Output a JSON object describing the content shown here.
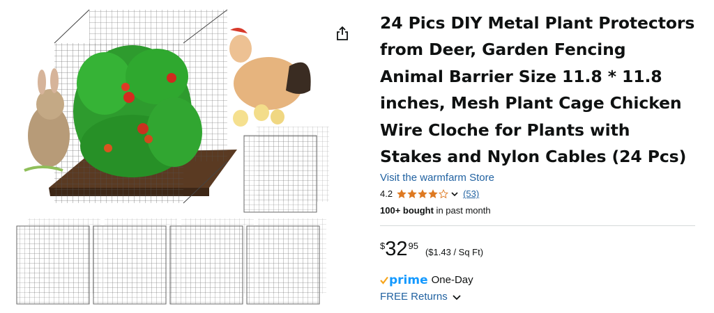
{
  "product": {
    "title_lines": [
      "24 Pics DIY Metal Plant Protectors",
      "from Deer, Garden Fencing",
      "Animal Barrier Size 11.8 * 11.8",
      "inches, Mesh Plant Cage Chicken",
      "Wire Cloche for Plants with",
      "Stakes and Nylon Cables (24 Pcs)"
    ],
    "store_link": "Visit the warmfarm Store",
    "rating": {
      "value": "4.2",
      "stars_filled": 4,
      "stars_total": 5,
      "count": "(53)"
    },
    "bought": {
      "bold": "100+ bought",
      "rest": " in past month"
    },
    "price": {
      "currency": "$",
      "whole": "32",
      "fraction": "95",
      "unit_price": "($1.43 / Sq Ft)"
    },
    "delivery": {
      "prime_label": "prime",
      "prime_option": "One-Day"
    },
    "returns": {
      "label": "FREE Returns"
    }
  },
  "icons": {
    "share": "share-icon",
    "star": "star-icon",
    "chevron": "chevron-down-icon",
    "prime_check": "prime-check-icon"
  },
  "colors": {
    "link": "#2162a1",
    "star": "#de7921",
    "prime": "#1399ff",
    "text": "#0f1111",
    "divider": "#d5d9d9"
  }
}
